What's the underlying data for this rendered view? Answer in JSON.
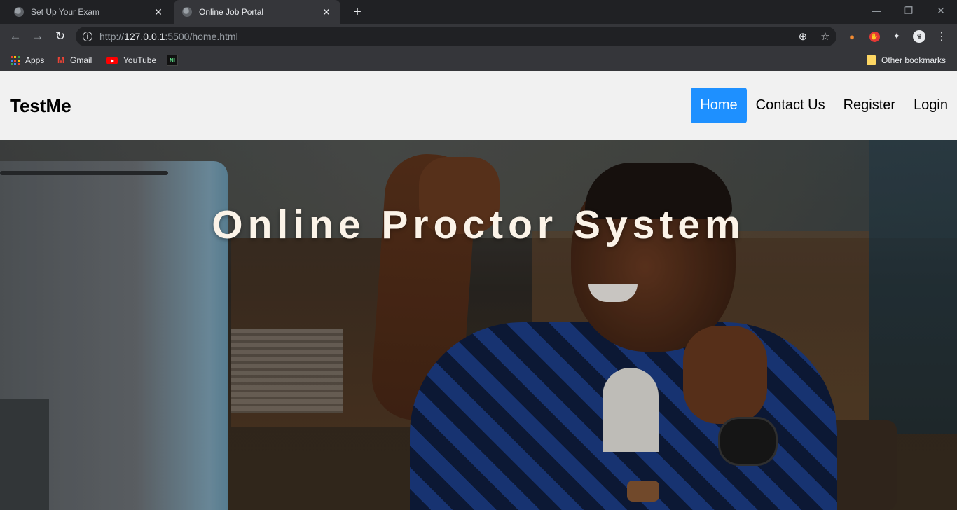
{
  "browser": {
    "tabs": [
      {
        "title": "Set Up Your Exam",
        "active": false
      },
      {
        "title": "Online Job Portal",
        "active": true
      }
    ],
    "new_tab_symbol": "+",
    "url": {
      "scheme": "http://",
      "host": "127.0.0.1",
      "rest": ":5500/home.html"
    },
    "bookmarks": [
      "Apps",
      "Gmail",
      "YouTube"
    ],
    "other_bookmarks": "Other bookmarks",
    "icons": [
      "back-arrow-icon",
      "forward-arrow-icon",
      "reload-icon",
      "site-info-icon",
      "zoom-icon",
      "star-icon",
      "extension-puzzle-icon",
      "chrome-menu-icon"
    ]
  },
  "site": {
    "logo": "TestMe",
    "nav": [
      {
        "label": "Home",
        "active": true
      },
      {
        "label": "Contact Us",
        "active": false
      },
      {
        "label": "Register",
        "active": false
      },
      {
        "label": "Login",
        "active": false
      }
    ],
    "hero_title": "Online Proctor System",
    "accent_color": "#1e90ff",
    "header_bg": "#f1f1f1"
  }
}
